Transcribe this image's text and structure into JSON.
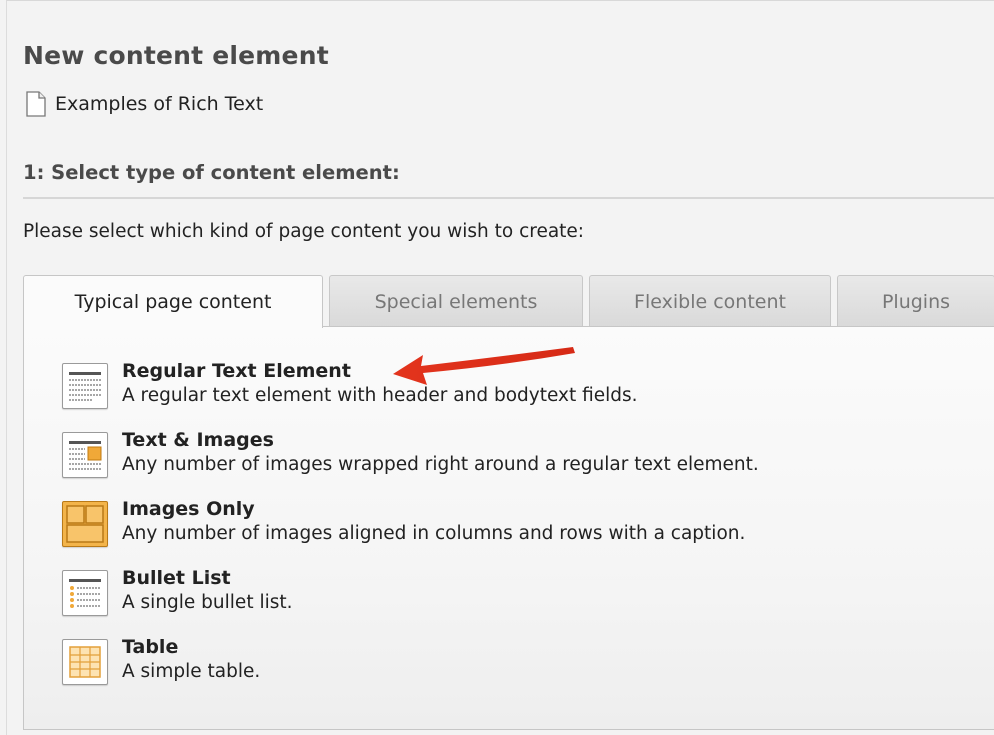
{
  "header": {
    "title": "New content element",
    "page_name": "Examples of Rich Text",
    "page_icon": "document-icon"
  },
  "step": {
    "title": "1: Select type of content element:",
    "instruction": "Please select which kind of page content you wish to create:"
  },
  "tabs": [
    {
      "label": "Typical page content",
      "active": true
    },
    {
      "label": "Special elements",
      "active": false
    },
    {
      "label": "Flexible content",
      "active": false
    },
    {
      "label": "Plugins",
      "active": false
    }
  ],
  "elements": [
    {
      "title": "Regular Text Element",
      "description": "A regular text element with header and bodytext fields.",
      "icon": "regular-text-icon"
    },
    {
      "title": "Text & Images",
      "description": "Any number of images wrapped right around a regular text element.",
      "icon": "text-images-icon"
    },
    {
      "title": "Images Only",
      "description": "Any number of images aligned in columns and rows with a caption.",
      "icon": "images-only-icon"
    },
    {
      "title": "Bullet List",
      "description": "A single bullet list.",
      "icon": "bullet-list-icon"
    },
    {
      "title": "Table",
      "description": "A simple table.",
      "icon": "table-icon"
    }
  ],
  "colors": {
    "annotation_arrow": "#e0321c",
    "icon_accent": "#f0a838"
  }
}
